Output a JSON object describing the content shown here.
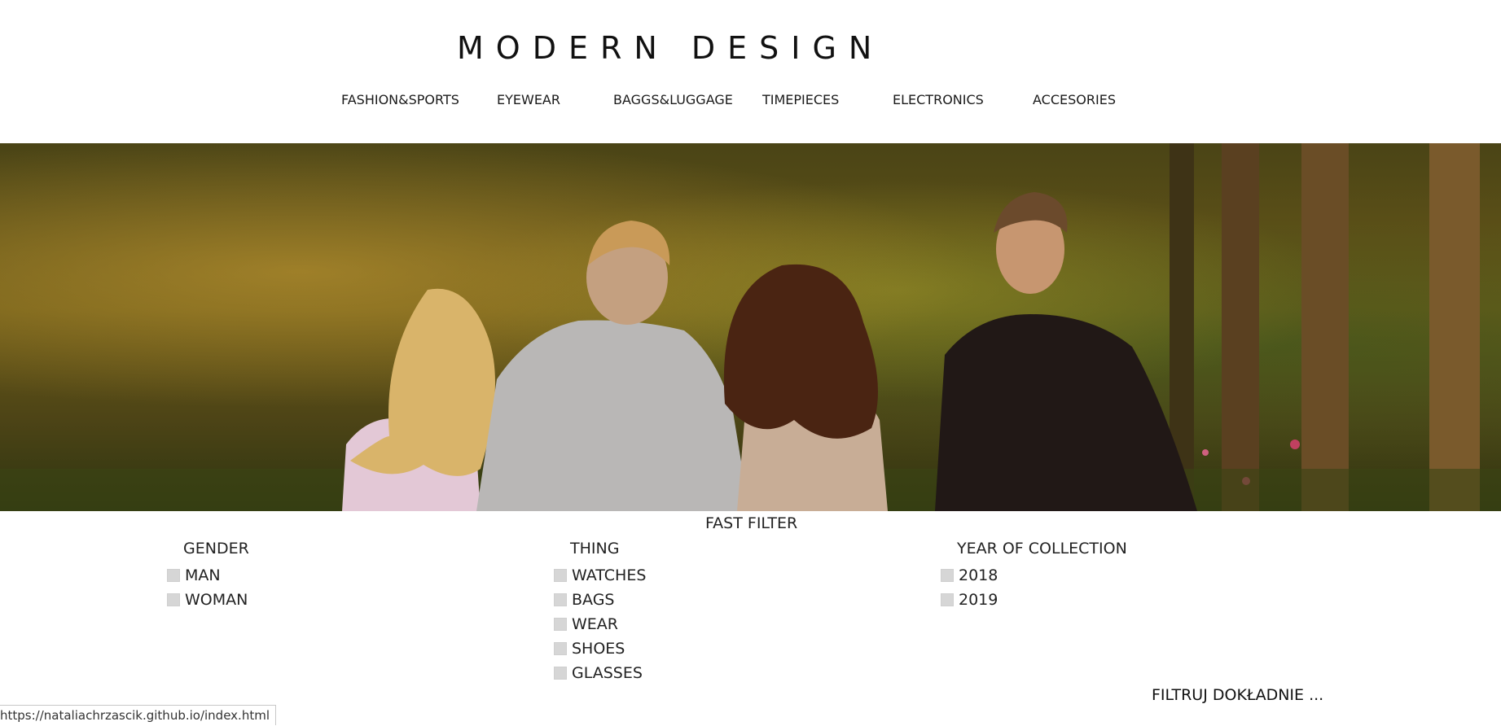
{
  "header": {
    "brand": "MODERN DESIGN"
  },
  "nav": {
    "items": [
      {
        "label": "FASHION&SPORTS"
      },
      {
        "label": "EYEWEAR"
      },
      {
        "label": "BAGGS&LUGGAGE"
      },
      {
        "label": "TIMEPIECES"
      },
      {
        "label": "ELECTRONICS"
      },
      {
        "label": "ACCESORIES"
      }
    ]
  },
  "hero": {
    "image": "photo of four young people walking away among autumn trees"
  },
  "filters": {
    "title": "FAST FILTER",
    "groups": [
      {
        "heading": "GENDER",
        "options": [
          {
            "label": "MAN",
            "checked": false
          },
          {
            "label": "WOMAN",
            "checked": false
          }
        ]
      },
      {
        "heading": "THING",
        "options": [
          {
            "label": "WATCHES",
            "checked": false
          },
          {
            "label": "BAGS",
            "checked": false
          },
          {
            "label": "WEAR",
            "checked": false
          },
          {
            "label": "SHOES",
            "checked": false
          },
          {
            "label": "GLASSES",
            "checked": false
          }
        ]
      },
      {
        "heading": "YEAR OF COLLECTION",
        "options": [
          {
            "label": "2018",
            "checked": false
          },
          {
            "label": "2019",
            "checked": false
          }
        ]
      }
    ],
    "more_link": "FILTRUJ DOKŁADNIE ..."
  },
  "status_bar": {
    "url": "https://nataliachrzascik.github.io/index.html"
  },
  "colors": {
    "background": "#ffffff",
    "text": "#1f1f1f",
    "checkbox": "#d6d6d6"
  }
}
